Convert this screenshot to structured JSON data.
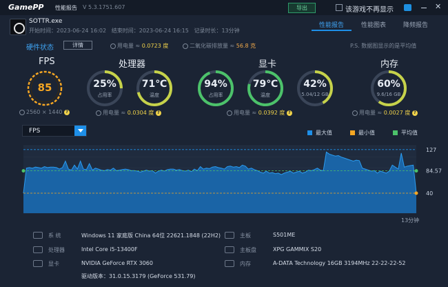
{
  "titlebar": {
    "logo": "GamePP",
    "title": "性能报告",
    "version": "V 5.3.1751.607",
    "export_label": "导出",
    "no_show_label": "该游戏不再显示"
  },
  "game": {
    "exe": "SOTTR.exe",
    "start_label": "开始时间：",
    "start": "2023-06-24 16:02",
    "end_label": "结束时间：",
    "end": "2023-06-24 16:15",
    "duration_label": "记录时长：",
    "duration": "13分钟"
  },
  "tabs": [
    {
      "label": "性能报告",
      "active": true
    },
    {
      "label": "性能图表",
      "active": false
    },
    {
      "label": "降频报告",
      "active": false
    }
  ],
  "status": {
    "title": "硬件状态",
    "detail_label": "详情",
    "power_label": "用电量 ≈",
    "power_value": "0.0723 度",
    "co2_label": "二氧化碳排放量 ≈",
    "co2_value": "56.8 克",
    "note": "P.S. 数据图显示的是平均值"
  },
  "sections": {
    "fps": {
      "title": "FPS",
      "value": "85",
      "resolution": "2560 × 1440"
    },
    "cpu": {
      "title": "处理器",
      "usage_value": "25%",
      "usage_label": "占用率",
      "usage_level": 0.25,
      "temp_value": "71℃",
      "temp_label": "温度",
      "temp_level": 0.71,
      "power_label": "用电量 ≈",
      "power_value": "0.0304 度"
    },
    "gpu": {
      "title": "显卡",
      "usage_value": "94%",
      "usage_label": "占用率",
      "usage_level": 0.94,
      "temp_value": "79℃",
      "temp_label": "温度",
      "temp_level": 0.79,
      "vram_value": "42%",
      "vram_label": "5.04/12 GB",
      "vram_level": 0.42,
      "power_label": "用电量 ≈",
      "power_value": "0.0392 度"
    },
    "mem": {
      "title": "内存",
      "usage_value": "60%",
      "usage_label": "9.6/16 GB",
      "usage_level": 0.6,
      "power_label": "用电量 ≈",
      "power_value": "0.0027 度"
    }
  },
  "chart_data": {
    "type": "area",
    "metric": "FPS",
    "legend": [
      "最大值",
      "最小值",
      "平均值"
    ],
    "max": 127,
    "avg": 84.57,
    "min": 40,
    "x_end_label": "13分钟",
    "values": [
      40,
      90,
      91,
      90,
      92,
      91,
      90,
      93,
      91,
      92,
      92,
      91,
      88,
      91,
      104,
      88,
      86,
      96,
      88,
      104,
      88,
      87,
      99,
      86,
      90,
      88,
      86,
      85,
      87,
      86,
      90,
      85,
      86,
      87,
      88,
      87,
      85,
      85,
      84,
      82,
      84,
      86,
      84,
      85,
      80,
      84,
      86,
      84,
      87,
      88,
      88,
      86,
      87,
      85,
      84,
      86,
      83,
      88,
      85,
      93,
      88,
      90,
      89,
      92,
      93,
      91,
      90,
      88,
      93,
      94,
      92,
      93,
      91,
      96,
      94,
      88,
      90,
      87,
      85,
      82,
      80,
      84,
      80,
      81,
      79,
      80,
      77,
      80,
      82,
      84,
      80,
      82,
      84,
      80,
      82,
      86,
      85,
      87,
      90,
      86,
      85,
      122,
      118,
      116,
      114,
      115,
      112,
      110,
      108,
      106,
      104,
      106,
      105,
      90,
      88,
      86,
      84,
      85,
      80,
      84,
      82,
      80,
      84,
      96,
      92,
      88,
      120,
      92,
      94,
      95,
      96,
      40
    ],
    "colors": {
      "max": "#1e8fe8",
      "min": "#f5a623",
      "avg": "#4cc26a",
      "fill": "#1a6fb8",
      "line": "#2b9cf0"
    }
  },
  "sysinfo": [
    {
      "key": "系  统",
      "value": "Windows 11 家庭版 China 64位 22621.1848 (22H2)"
    },
    {
      "key": "主板",
      "value": "S501ME"
    },
    {
      "key": "处理器",
      "value": "Intel Core i5-13400F"
    },
    {
      "key": "主板盘",
      "value": "XPG GAMMIX S20"
    },
    {
      "key": "显卡",
      "value": "NVIDIA GeForce RTX 3060"
    },
    {
      "key": "内存",
      "value": "A-DATA Technology 16GB 3194MHz 22-22-22-52"
    },
    {
      "key": "",
      "value": "驱动版本：31.0.15.3179 (GeForce 531.79)"
    }
  ]
}
